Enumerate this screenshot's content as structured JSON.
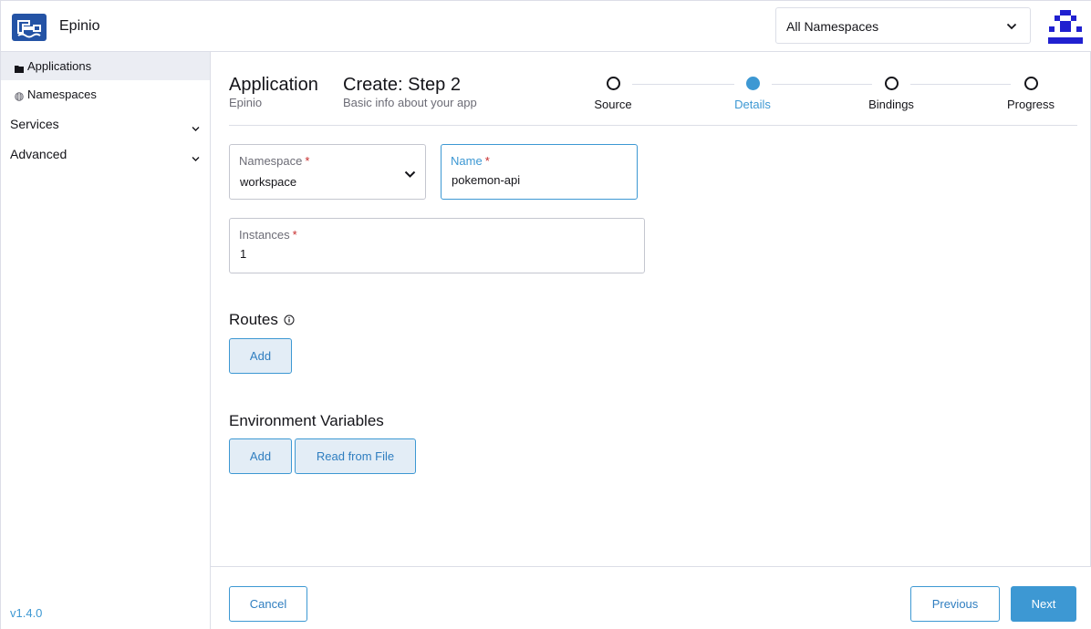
{
  "header": {
    "app_name": "Epinio",
    "namespace_filter": "All Namespaces"
  },
  "sidebar": {
    "items": [
      {
        "label": "Applications",
        "icon": "folder-icon"
      },
      {
        "label": "Namespaces",
        "icon": "globe-icon"
      }
    ],
    "groups": [
      {
        "label": "Services"
      },
      {
        "label": "Advanced"
      }
    ],
    "version": "v1.4.0"
  },
  "page": {
    "title": "Application",
    "subtitle": "Epinio",
    "step_title": "Create: Step 2",
    "step_subtitle": "Basic info about your app"
  },
  "stepper": {
    "current": "Details",
    "steps": [
      {
        "label": "Source"
      },
      {
        "label": "Details"
      },
      {
        "label": "Bindings"
      },
      {
        "label": "Progress"
      }
    ]
  },
  "form": {
    "namespace": {
      "label": "Namespace",
      "required": "*",
      "value": "workspace"
    },
    "name": {
      "label": "Name",
      "required": "*",
      "value": "pokemon-api"
    },
    "instances": {
      "label": "Instances",
      "required": "*",
      "value": "1"
    }
  },
  "routes": {
    "title": "Routes",
    "add_label": "Add"
  },
  "env": {
    "title": "Environment Variables",
    "add_label": "Add",
    "read_file_label": "Read from File"
  },
  "footer": {
    "cancel_label": "Cancel",
    "previous_label": "Previous",
    "next_label": "Next"
  },
  "colors": {
    "accent": "#3d98d3",
    "brand": "#2453a5",
    "required": "#c72c2c"
  }
}
